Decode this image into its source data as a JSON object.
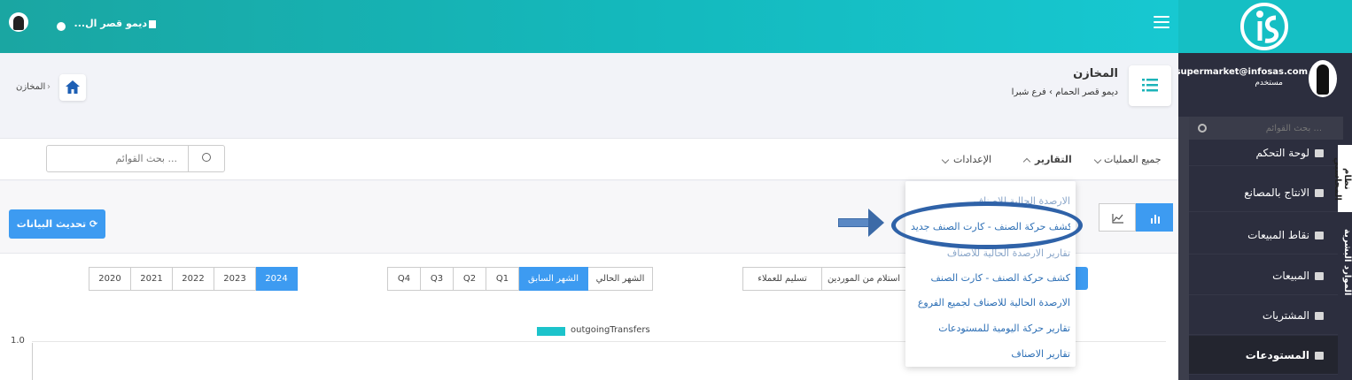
{
  "topbar": {
    "branch_label": "ديمو قصر ال..."
  },
  "sidebar": {
    "user_email": "supermarket@infosas.com",
    "user_role": "مستخدم",
    "search_placeholder": "بحث القوائم ...",
    "items": [
      {
        "label": "لوحة التحكم",
        "icon": "dashboard-icon"
      },
      {
        "label": "الانتاج بالمصانع",
        "icon": "factory-icon"
      },
      {
        "label": "نقاط المبيعات",
        "icon": "pos-icon"
      },
      {
        "label": "المبيعات",
        "icon": "truck-icon"
      },
      {
        "label": "المشتريات",
        "icon": "purchases-icon"
      },
      {
        "label": "المستودعات",
        "icon": "warehouse-icon"
      }
    ],
    "vertical_tabs": [
      "نظام المحاسبي",
      "الموارد البشرية"
    ]
  },
  "header": {
    "title": "المخازن",
    "subtitle_company": "ديمو قصر الحمام",
    "subtitle_branch": "فرع شبرا",
    "breadcrumb": "المخازن"
  },
  "menubar": {
    "search_placeholder": "بحث القوائم ...",
    "items": [
      "جميع العمليات",
      "التقارير",
      "الإعدادات"
    ]
  },
  "toolbar": {
    "refresh_label": "تحديث البيانات"
  },
  "operations": [
    "استلام من الموردين",
    "تسليم للعملاء"
  ],
  "periods": [
    "الشهر الحالي",
    "الشهر السابق",
    "Q1",
    "Q2",
    "Q3",
    "Q4"
  ],
  "years": [
    "2024",
    "2023",
    "2022",
    "2021",
    "2020"
  ],
  "chart": {
    "legend": "outgoingTransfers",
    "y_tick": "1.0",
    "color": "#1cc3cb"
  },
  "reports_dropdown": [
    "الارصدة الحالية للاصناف",
    "كشف حركة الصنف - كارت الصنف جديد",
    "تقارير الارصدة الحالية للاصناف",
    "كشف حركة الصنف - كارت الصنف",
    "الارصدة الحالية للاصناف لجميع الفروع",
    "تقارير حركة اليومية للمستودعات",
    "تقارير الاصناف"
  ],
  "colors": {
    "accent": "#3d9bf1",
    "topbar": "#17b9bd",
    "sidebar": "#2c2e3e"
  }
}
